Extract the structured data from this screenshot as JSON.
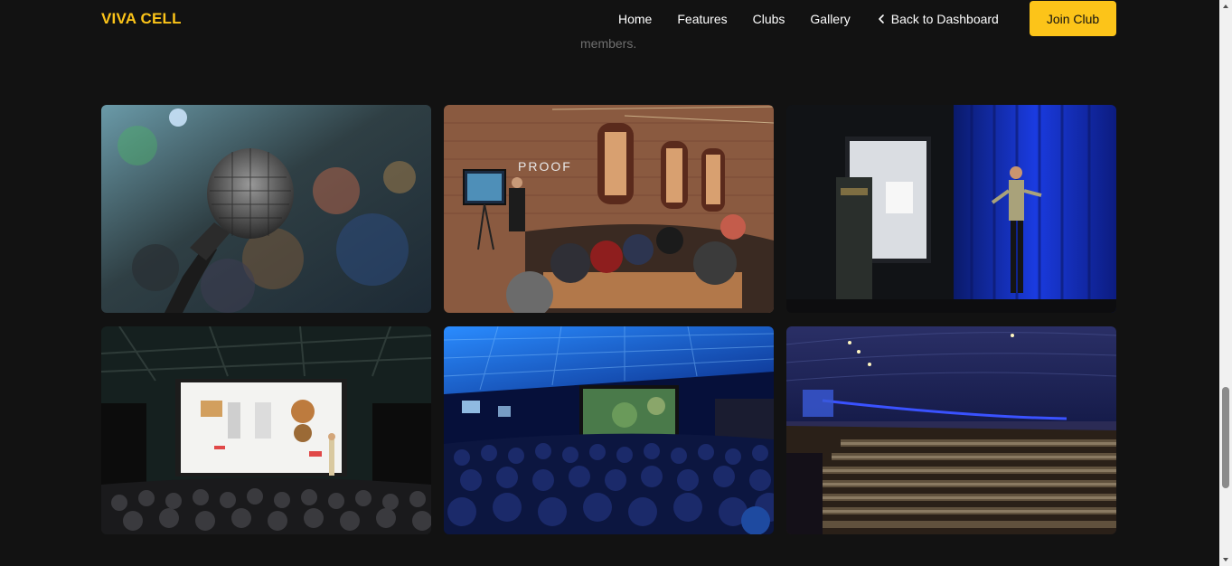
{
  "navbar": {
    "brand": "VIVA CELL",
    "links": [
      "Home",
      "Features",
      "Clubs",
      "Gallery"
    ],
    "back_label": "Back to Dashboard",
    "join_label": "Join Club"
  },
  "partial_text": "members.",
  "gallery": {
    "images": [
      {
        "subject": "microphone-closeup"
      },
      {
        "subject": "brick-room-presentation"
      },
      {
        "subject": "stage-speaker-blue-curtain"
      },
      {
        "subject": "warehouse-screen-presentation"
      },
      {
        "subject": "blue-ballroom-audience"
      },
      {
        "subject": "large-arena-crowd"
      }
    ]
  },
  "colors": {
    "accent": "#fcc419",
    "background": "#121212"
  }
}
